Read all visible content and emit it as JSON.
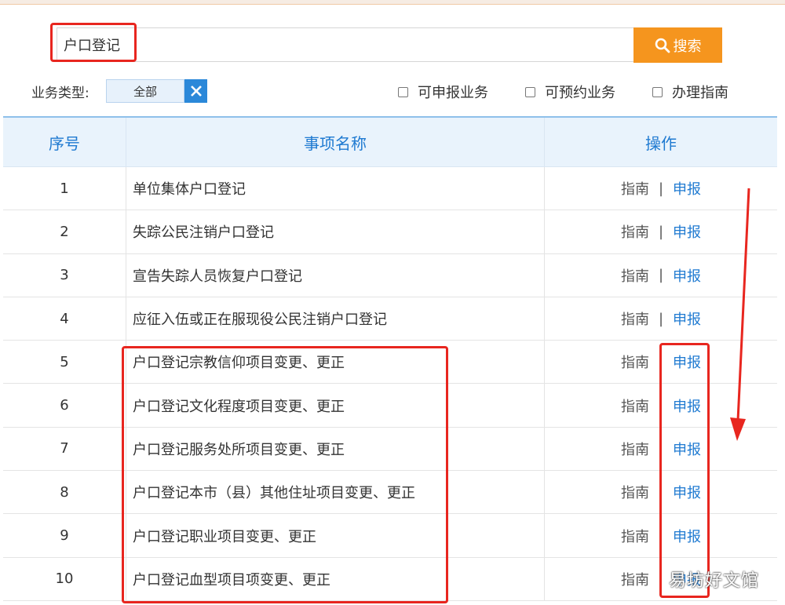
{
  "search": {
    "value": "户口登记",
    "placeholder": "",
    "button_label": "搜索"
  },
  "filters": {
    "type_label": "业务类型:",
    "type_value": "全部",
    "checkboxes": [
      {
        "label": "可申报业务",
        "checked": false
      },
      {
        "label": "可预约业务",
        "checked": false
      },
      {
        "label": "办理指南",
        "checked": false
      }
    ]
  },
  "table": {
    "headers": [
      "序号",
      "事项名称",
      "操作"
    ],
    "guide_label": "指南",
    "separator": "|",
    "apply_label": "申报",
    "rows": [
      {
        "no": "1",
        "name": "单位集体户口登记"
      },
      {
        "no": "2",
        "name": "失踪公民注销户口登记"
      },
      {
        "no": "3",
        "name": "宣告失踪人员恢复户口登记"
      },
      {
        "no": "4",
        "name": "应征入伍或正在服现役公民注销户口登记"
      },
      {
        "no": "5",
        "name": "户口登记宗教信仰项目变更、更正"
      },
      {
        "no": "6",
        "name": "户口登记文化程度项目变更、更正"
      },
      {
        "no": "7",
        "name": "户口登记服务处所项目变更、更正"
      },
      {
        "no": "8",
        "name": "户口登记本市（县）其他住址项目变更、更正"
      },
      {
        "no": "9",
        "name": "户口登记职业项目变更、更正"
      },
      {
        "no": "10",
        "name": "户口登记血型项目项变更、更正"
      }
    ]
  },
  "watermark": "易坊好文馆",
  "colors": {
    "accent": "#f5951e",
    "link": "#1f7ad1",
    "annotation": "#e8261f"
  }
}
